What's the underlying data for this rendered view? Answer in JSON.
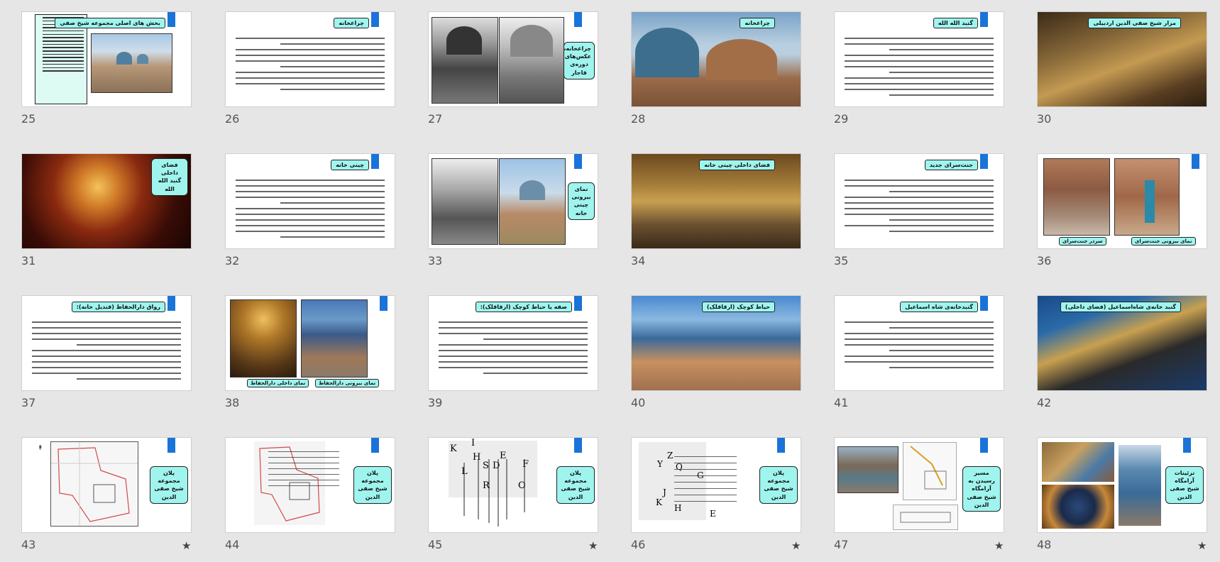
{
  "slides": [
    {
      "num": "25",
      "title": "بخش های اصلی مجموعه شیخ صفی"
    },
    {
      "num": "26",
      "title": "چراغخانه"
    },
    {
      "num": "27",
      "box": "چراغخانه، عکس‌های دوره‌ی قاجار"
    },
    {
      "num": "28",
      "title": "چراغخانه"
    },
    {
      "num": "29",
      "title": "گنبد الله الله"
    },
    {
      "num": "30",
      "title": "مزار شیخ صفی الدین اردبیلی"
    },
    {
      "num": "31",
      "box": "فضای داخلی گنبد الله الله"
    },
    {
      "num": "32",
      "title": "چینی خانه"
    },
    {
      "num": "33",
      "box": "نمای بیرونی چینی خانه"
    },
    {
      "num": "34",
      "title": "فضای داخلی چینی خانه"
    },
    {
      "num": "35",
      "title": "جنت‌سرای جدید"
    },
    {
      "num": "36",
      "caption_left": "سردر جنت‌سرای",
      "caption_right": "نمای بیرونی جنت‌سرای"
    },
    {
      "num": "37",
      "title": "رواق دارالحفاظ (قندیل خانه):"
    },
    {
      "num": "38",
      "caption_left": "نمای داخلی دارالحفاظ",
      "caption_right": "نمای بیرونی دارالحفاظ"
    },
    {
      "num": "39",
      "title": "صفه یا حیاط کوچک (ارقاقلک):"
    },
    {
      "num": "40",
      "title": "حیاط کوچک (ارقاقلک)"
    },
    {
      "num": "41",
      "title": "گنبدخانه‌ی شاه اسماعیل"
    },
    {
      "num": "42",
      "title": "گنبد خانه‌ی شاه‌اسماعیل (فضای داخلی)"
    },
    {
      "num": "43",
      "box": "پلان مجموعه شیخ صفی الدین",
      "star": "★"
    },
    {
      "num": "44",
      "box": "پلان مجموعه شیخ صفی الدین"
    },
    {
      "num": "45",
      "box": "پلان مجموعه شیخ صفی الدین",
      "star": "★",
      "letters": [
        "K",
        "I",
        "H",
        "S",
        "D",
        "E",
        "F",
        "L",
        "R",
        "O"
      ]
    },
    {
      "num": "46",
      "box": "پلان مجموعه شیخ صفی الدین",
      "star": "★",
      "letters": [
        "Z",
        "Y",
        "Q",
        "G",
        "J",
        "K",
        "H",
        "E"
      ]
    },
    {
      "num": "47",
      "box": "مسیر رسیدن به آرامگاه شیخ صفی الدین",
      "star": "★"
    },
    {
      "num": "48",
      "box": "تزئینات آرامگاه شیخ صفی الدین",
      "star": "★"
    }
  ],
  "colors": {
    "accent": "#1a73d8",
    "label_bg": "#9ff4ee"
  }
}
